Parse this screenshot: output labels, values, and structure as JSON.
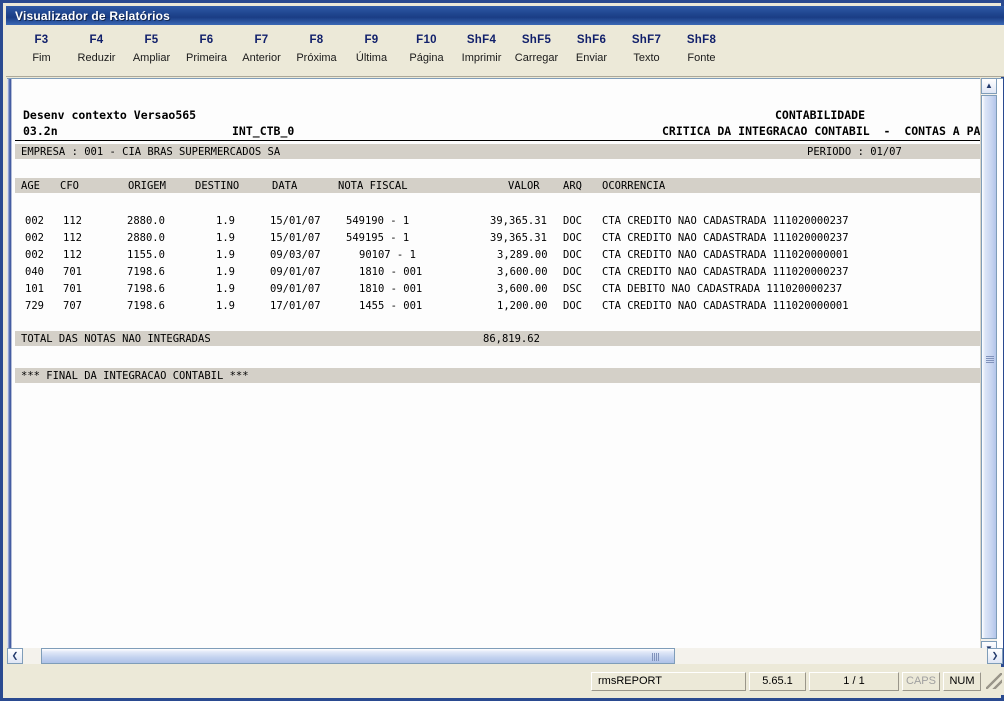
{
  "window": {
    "title": "Visualizador de Relatórios"
  },
  "toolbar": {
    "buttons": [
      {
        "key": "F3",
        "label": "Fim"
      },
      {
        "key": "F4",
        "label": "Reduzir"
      },
      {
        "key": "F5",
        "label": "Ampliar"
      },
      {
        "key": "F6",
        "label": "Primeira"
      },
      {
        "key": "F7",
        "label": "Anterior"
      },
      {
        "key": "F8",
        "label": "Próxima"
      },
      {
        "key": "F9",
        "label": "Última"
      },
      {
        "key": "F10",
        "label": "Página"
      },
      {
        "key": "ShF4",
        "label": "Imprimir"
      },
      {
        "key": "ShF5",
        "label": "Carregar"
      },
      {
        "key": "ShF6",
        "label": "Enviar"
      },
      {
        "key": "ShF7",
        "label": "Texto"
      },
      {
        "key": "ShF8",
        "label": "Fonte"
      }
    ]
  },
  "report": {
    "context_line": "Desenv contexto Versao565",
    "version_line": "03.2n",
    "program_id": "INT_CTB_0",
    "header_right_1": "CONTABILIDADE",
    "header_right_2": "CRITICA DA INTEGRACAO CONTABIL  -  CONTAS A PAGAR",
    "company_line": "EMPRESA : 001 - CIA BRAS SUPERMERCADOS SA",
    "period_line": "PERIODO : 01/07",
    "columns": {
      "age": "AGE",
      "cfo": "CFO",
      "origem": "ORIGEM",
      "destino": "DESTINO",
      "data": "DATA",
      "nota_fiscal": "NOTA FISCAL",
      "valor": "VALOR",
      "arq": "ARQ",
      "ocorrencia": "OCORRENCIA"
    },
    "rows": [
      {
        "age": "002",
        "cfo": "112",
        "origem": "2880.0",
        "destino": "1.9",
        "data": "15/01/07",
        "nota_fiscal": "549190 - 1",
        "valor": "39,365.31",
        "arq": "DOC",
        "ocorrencia": "CTA CREDITO NAO CADASTRADA 111020000237"
      },
      {
        "age": "002",
        "cfo": "112",
        "origem": "2880.0",
        "destino": "1.9",
        "data": "15/01/07",
        "nota_fiscal": "549195 - 1",
        "valor": "39,365.31",
        "arq": "DOC",
        "ocorrencia": "CTA CREDITO NAO CADASTRADA 111020000237"
      },
      {
        "age": "002",
        "cfo": "112",
        "origem": "1155.0",
        "destino": "1.9",
        "data": "09/03/07",
        "nota_fiscal": "90107 - 1",
        "valor": "3,289.00",
        "arq": "DOC",
        "ocorrencia": "CTA CREDITO NAO CADASTRADA 111020000001"
      },
      {
        "age": "040",
        "cfo": "701",
        "origem": "7198.6",
        "destino": "1.9",
        "data": "09/01/07",
        "nota_fiscal": "1810 - 001",
        "valor": "3,600.00",
        "arq": "DOC",
        "ocorrencia": "CTA CREDITO NAO CADASTRADA 111020000237"
      },
      {
        "age": "101",
        "cfo": "701",
        "origem": "7198.6",
        "destino": "1.9",
        "data": "09/01/07",
        "nota_fiscal": "1810 - 001",
        "valor": "3,600.00",
        "arq": "DSC",
        "ocorrencia": "CTA DEBITO NAO CADASTRADA 111020000237"
      },
      {
        "age": "729",
        "cfo": "707",
        "origem": "7198.6",
        "destino": "1.9",
        "data": "17/01/07",
        "nota_fiscal": "1455 - 001",
        "valor": "1,200.00",
        "arq": "DOC",
        "ocorrencia": "CTA CREDITO NAO CADASTRADA 111020000001"
      }
    ],
    "total_label": "TOTAL DAS NOTAS NAO INTEGRADAS",
    "total_value": "86,819.62",
    "final_line": "*** FINAL DA INTEGRACAO CONTABIL ***"
  },
  "statusbar": {
    "app": "rmsREPORT",
    "version": "5.65.1",
    "page": "1 / 1",
    "caps": "CAPS",
    "num": "NUM"
  },
  "scrollbars": {
    "up_arrow": "▲",
    "down_arrow": "▼",
    "left_arrow": "❮",
    "right_arrow": "❯"
  }
}
